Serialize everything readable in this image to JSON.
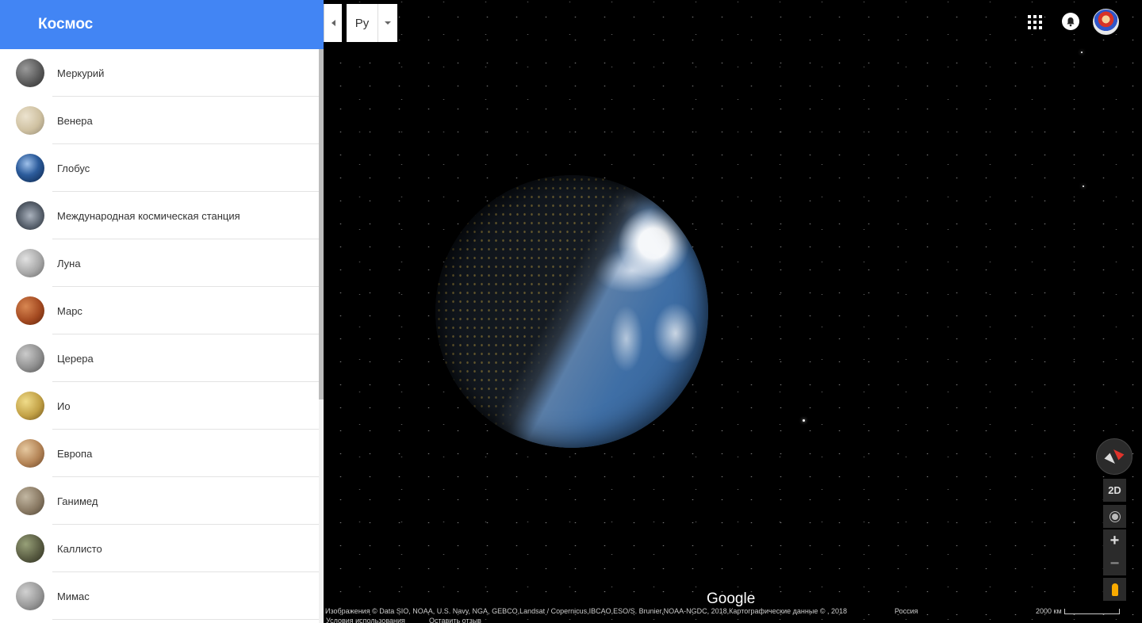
{
  "sidebar": {
    "title": "Космос",
    "items": [
      {
        "label": "Меркурий",
        "thumb": "mercury"
      },
      {
        "label": "Венера",
        "thumb": "venus"
      },
      {
        "label": "Глобус",
        "thumb": "earth"
      },
      {
        "label": "Международная космическая станция",
        "thumb": "iss"
      },
      {
        "label": "Луна",
        "thumb": "moon"
      },
      {
        "label": "Марс",
        "thumb": "mars"
      },
      {
        "label": "Церера",
        "thumb": "ceres"
      },
      {
        "label": "Ио",
        "thumb": "io"
      },
      {
        "label": "Европа",
        "thumb": "europa"
      },
      {
        "label": "Ганимед",
        "thumb": "ganymede"
      },
      {
        "label": "Каллисто",
        "thumb": "callisto"
      },
      {
        "label": "Мимас",
        "thumb": "mimas"
      }
    ]
  },
  "toolbar": {
    "language": "Ру"
  },
  "header_icons": [
    "apps-grid-icon",
    "notifications-icon",
    "avatar"
  ],
  "controls": {
    "view_mode": "2D",
    "zoom_in": "+",
    "zoom_out": "−"
  },
  "footer": {
    "logo": "Google",
    "attribution": "Изображения © Data SIO, NOAA, U.S. Navy, NGA, GEBCO,Landsat / Copernicus,IBCAO,ESO/S. Brunier,NOAA-NGDC, 2018,Картографические данные © , 2018",
    "region": "Россия",
    "scale": "2000 км",
    "terms": "Условия использования",
    "feedback": "Оставить отзыв"
  },
  "colors": {
    "header_blue": "#4285f4",
    "space": "#000000"
  }
}
